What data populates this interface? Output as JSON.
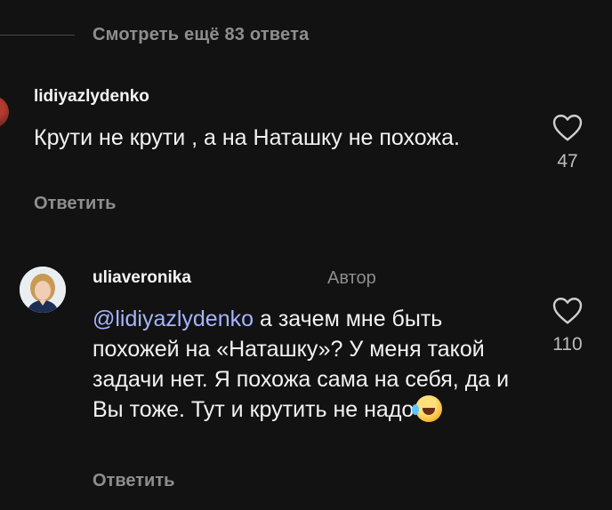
{
  "view_more": {
    "label": "Смотреть ещё 83 ответа"
  },
  "comments": [
    {
      "username": "lidiyazlydenko",
      "text": "Крути не крути , а на Наташку не похожа.",
      "likes": "47",
      "reply_label": "Ответить"
    },
    {
      "username": "uliaveronika",
      "author_tag": "Автор",
      "mention": "@lidiyazlydenko",
      "text": " а зачем мне быть похожей на «Наташку»? У меня такой задачи нет. Я похожа сама на себя, да и Вы тоже. Тут и крутить не надо",
      "emoji": "rolling-on-floor-laughing-emoji",
      "likes": "110",
      "reply_label": "Ответить"
    }
  ],
  "icons": {
    "like": "heart-outline-icon"
  }
}
